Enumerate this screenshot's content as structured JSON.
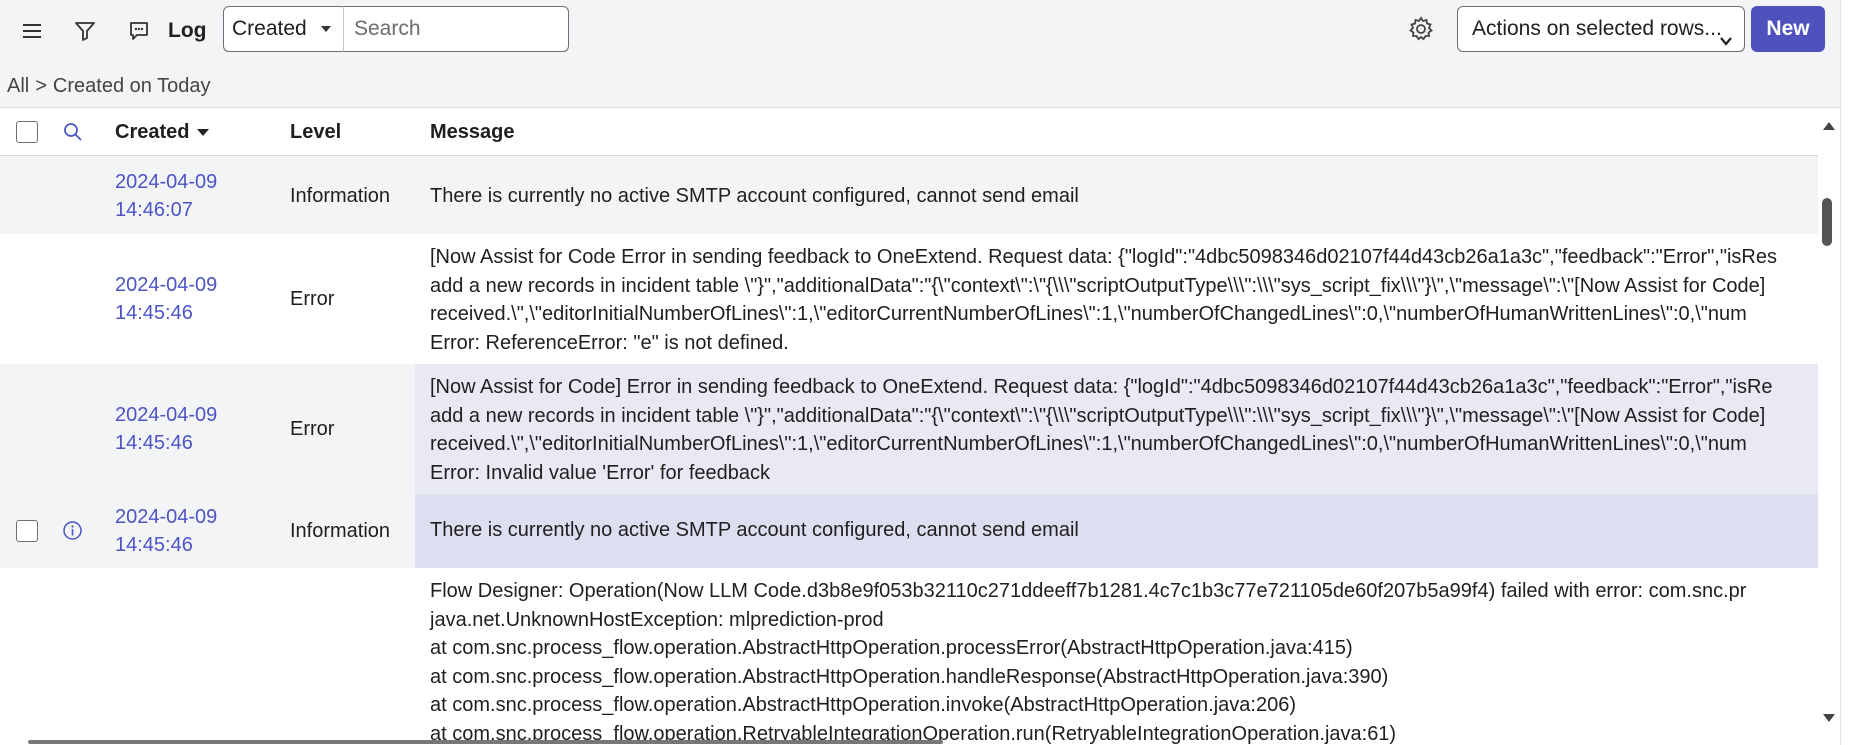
{
  "toolbar": {
    "title": "Log",
    "filter_select_value": "Created",
    "search_placeholder": "Search",
    "actions_select_value": "Actions on selected rows...",
    "new_button_label": "New"
  },
  "breadcrumb": {
    "all": "All",
    "separator": ">",
    "filter": "Created on Today"
  },
  "table": {
    "columns": {
      "created": "Created",
      "level": "Level",
      "message": "Message"
    },
    "sort_column": "Created",
    "rows": [
      {
        "created_date": "2024-04-09",
        "created_time": "14:46:07",
        "level": "Information",
        "message": "There is currently no active SMTP account configured, cannot send email"
      },
      {
        "created_date": "2024-04-09",
        "created_time": "14:45:46",
        "level": "Error",
        "message": "[Now Assist for Code Error in sending feedback to OneExtend. Request data: {\"logId\":\"4dbc5098346d02107f44d43cb26a1a3c\",\"feedback\":\"Error\",\"isRes\nadd a new records in incident table \\\"}\",\"additionalData\":\"{\\\"context\\\":\\\"{\\\\\\\"scriptOutputType\\\\\\\":\\\\\\\"sys_script_fix\\\\\\\"}\\\",\\\"message\\\":\\\"[Now Assist for Code]\nreceived.\\\",\\\"editorInitialNumberOfLines\\\":1,\\\"editorCurrentNumberOfLines\\\":1,\\\"numberOfChangedLines\\\":0,\\\"numberOfHumanWrittenLines\\\":0,\\\"num\nError: ReferenceError: \"e\" is not defined."
      },
      {
        "created_date": "2024-04-09",
        "created_time": "14:45:46",
        "level": "Error",
        "message": "[Now Assist for Code] Error in sending feedback to OneExtend. Request data: {\"logId\":\"4dbc5098346d02107f44d43cb26a1a3c\",\"feedback\":\"Error\",\"isRe\nadd a new records in incident table \\\"}\",\"additionalData\":\"{\\\"context\\\":\\\"{\\\\\\\"scriptOutputType\\\\\\\":\\\\\\\"sys_script_fix\\\\\\\"}\\\",\\\"message\\\":\\\"[Now Assist for Code]\nreceived.\\\",\\\"editorInitialNumberOfLines\\\":1,\\\"editorCurrentNumberOfLines\\\":1,\\\"numberOfChangedLines\\\":0,\\\"numberOfHumanWrittenLines\\\":0,\\\"num\nError: Invalid value 'Error' for feedback"
      },
      {
        "created_date": "2024-04-09",
        "created_time": "14:45:46",
        "level": "Information",
        "message": "There is currently no active SMTP account configured, cannot send email"
      },
      {
        "created_date": "",
        "created_time": "",
        "level": "",
        "message": "Flow Designer: Operation(Now LLM Code.d3b8e9f053b32110c271ddeeff7b1281.4c7c1b3c77e721105de60f207b5a99f4) failed with error: com.snc.pr\njava.net.UnknownHostException: mlprediction-prod\nat com.snc.process_flow.operation.AbstractHttpOperation.processError(AbstractHttpOperation.java:415)\nat com.snc.process_flow.operation.AbstractHttpOperation.handleResponse(AbstractHttpOperation.java:390)\nat com.snc.process_flow.operation.AbstractHttpOperation.invoke(AbstractHttpOperation.java:206)\nat com.snc.process_flow.operation.RetryableIntegrationOperation.run(RetryableIntegrationOperation.java:61)"
      }
    ]
  },
  "colors": {
    "accent": "#4f52bd",
    "link": "#4c54c6",
    "toolbar_bg": "#f3f4f6"
  }
}
